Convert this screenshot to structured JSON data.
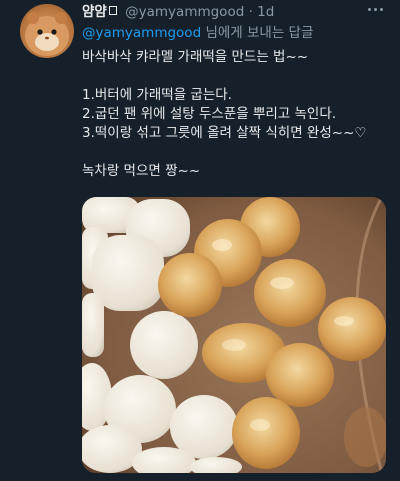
{
  "author": {
    "name": "얌얌",
    "handle": "@yamyammgood",
    "separator": "·",
    "time": "1d"
  },
  "reply": {
    "mention": "@yamyammgood",
    "suffix": "님에게 보내는 답글"
  },
  "tweet": {
    "lines": [
      "바삭바삭 캬라멜 가래떡을 만드는 법~~",
      "1.버터에 가래떡을 굽는다.",
      "2.굽던 팬 위에 설탕 두스푼을 뿌리고 녹인다.",
      "3.떡이랑 섞고 그릇에 올려 살짝 식히면 완성~~♡",
      "녹차랑 먹으면 짱~~"
    ]
  },
  "icons": {
    "avatar": "hamster-avatar",
    "more": "more-icon"
  },
  "colors": {
    "background": "#15202b",
    "text": "#e7e9ea",
    "secondary": "#8b98a5",
    "link": "#1d9bf0"
  }
}
